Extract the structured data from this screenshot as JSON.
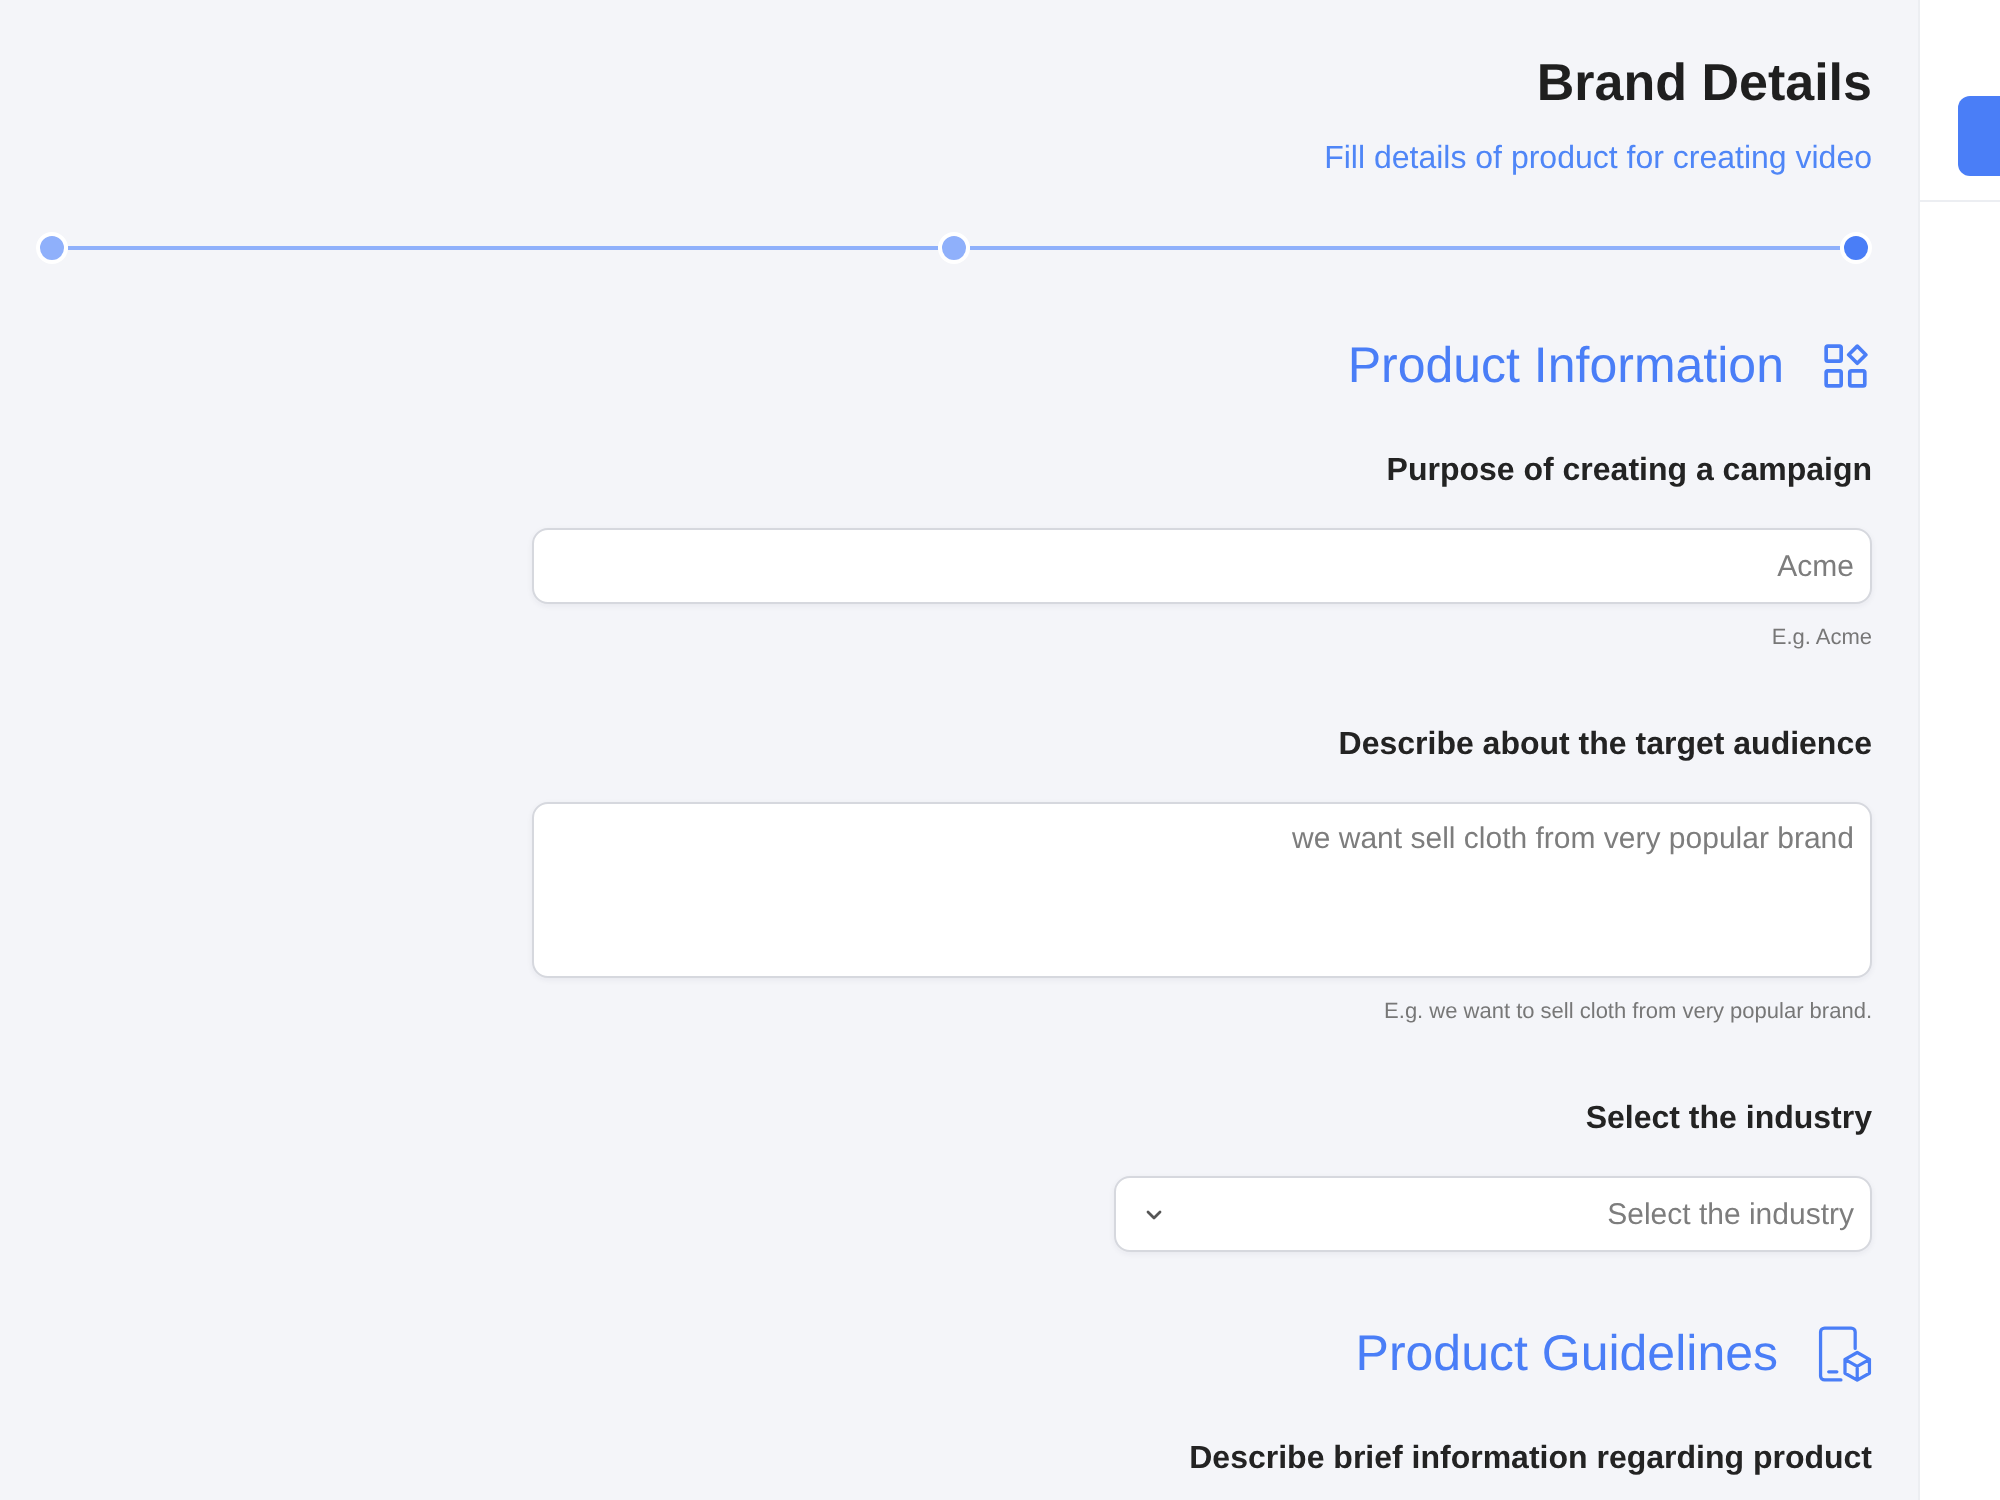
{
  "header": {
    "title": "Brand Details",
    "subtitle": "Fill details of product for creating video"
  },
  "stepper": {
    "steps": [
      {
        "selected": false
      },
      {
        "selected": false
      },
      {
        "selected": true
      }
    ]
  },
  "sections": [
    {
      "title": "Product Information",
      "fields": [
        {
          "kind": "input",
          "label": "Purpose of creating a campaign",
          "placeholder": "Acme",
          "hint": "E.g. Acme"
        },
        {
          "kind": "textarea",
          "label": "Describe about the target audience",
          "placeholder": "we want sell cloth from very popular brand",
          "hint": "E.g. we want to sell cloth from very popular brand."
        },
        {
          "kind": "select",
          "label": "Select the industry",
          "placeholder": "Select the industry"
        }
      ]
    },
    {
      "title": "Product Guidelines",
      "fields": [
        {
          "label": "Describe brief information regarding product"
        }
      ]
    }
  ]
}
